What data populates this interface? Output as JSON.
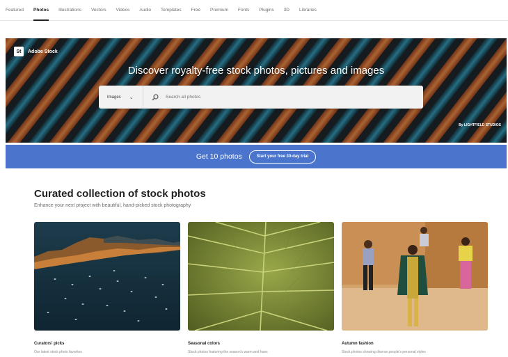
{
  "nav": {
    "items": [
      "Featured",
      "Photos",
      "Illustrations",
      "Vectors",
      "Videos",
      "Audio",
      "Templates",
      "Free",
      "Premium",
      "Fonts",
      "Plugins",
      "3D",
      "Libraries"
    ],
    "active": "Photos"
  },
  "hero": {
    "logo_badge": "St",
    "logo_text": "Adobe Stock",
    "title": "Discover royalty-free stock photos, pictures and images",
    "search": {
      "type_value": "Images",
      "placeholder": "Search all photos"
    },
    "credit": "By LIGHTFIELD STUDIOS"
  },
  "promo": {
    "text": "Get 10 photos",
    "button": "Start your free 30-day trial"
  },
  "section": {
    "title": "Curated collection of stock photos",
    "subtitle": "Enhance your next project with beautiful, hand-picked stock photography",
    "cards": [
      {
        "title": "Curators' picks",
        "desc": "Our latest stock photo favorites"
      },
      {
        "title": "Seasonal colors",
        "desc": "Stock photos featuring the season's warm and hues"
      },
      {
        "title": "Autumn fashion",
        "desc": "Stock photos showing diverse people's personal styles"
      }
    ]
  },
  "colors": {
    "promo_bg": "#4b75cc",
    "hero_stripe_orange": "#c46a35",
    "hero_stripe_teal": "#2a6f86"
  }
}
